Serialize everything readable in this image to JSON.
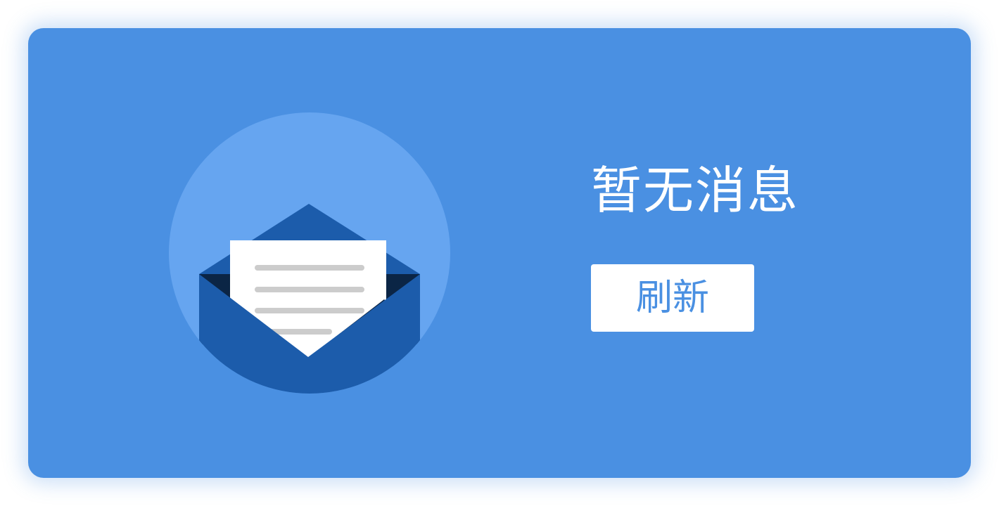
{
  "empty_state": {
    "illustration_icon": "open-envelope-with-letter-icon",
    "message": "暂无消息",
    "refresh_label": "刷新"
  },
  "colors": {
    "card_background": "#4a90e2",
    "circle": "#66a5f0",
    "envelope": "#1c5cab",
    "envelope_shadow": "#0b2545",
    "letter": "#ffffff",
    "letter_lines": "#cccccc",
    "button_background": "#ffffff",
    "button_text": "#4a90e2",
    "message_text": "#ffffff"
  }
}
